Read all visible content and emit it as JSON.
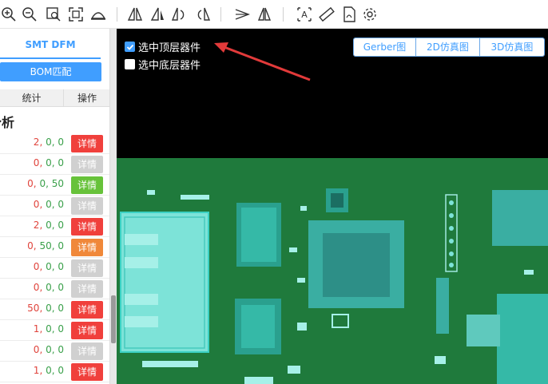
{
  "toolbar": {
    "icons": [
      "zoom-in-icon",
      "zoom-out-icon",
      "zoom-area-icon",
      "fit-view-icon",
      "board-edge-icon",
      "flip-horizontal-icon",
      "flip-vertical-icon",
      "rotate-left-icon",
      "rotate-right-icon",
      "pen-icon",
      "mirror-icon",
      "text-icon",
      "ruler-icon",
      "pdf-icon",
      "gear-icon"
    ]
  },
  "left_panel": {
    "tab": "SMT DFM",
    "bom_button": "BOM匹配",
    "headers": {
      "stat": "统计",
      "op": "操作"
    },
    "section_title": "分析",
    "rows": [
      {
        "a": "2",
        "b": "0",
        "c": "0",
        "op": "详情",
        "status": "red"
      },
      {
        "a": "0",
        "b": "0",
        "c": "0",
        "op": "详情",
        "status": "gray"
      },
      {
        "a": "0",
        "b": "0",
        "c": "50",
        "op": "详情",
        "status": "green"
      },
      {
        "a": "0",
        "b": "0",
        "c": "0",
        "op": "详情",
        "status": "gray"
      },
      {
        "a": "2",
        "b": "0",
        "c": "0",
        "op": "详情",
        "status": "red"
      },
      {
        "a": "0",
        "b": "50",
        "c": "0",
        "op": "详情",
        "status": "orange"
      },
      {
        "a": "0",
        "b": "0",
        "c": "0",
        "op": "详情",
        "status": "gray"
      },
      {
        "a": "0",
        "b": "0",
        "c": "0",
        "op": "详情",
        "status": "gray"
      },
      {
        "a": "50",
        "b": "0",
        "c": "0",
        "op": "详情",
        "status": "red"
      },
      {
        "a": "1",
        "b": "0",
        "c": "0",
        "op": "详情",
        "status": "red"
      },
      {
        "a": "0",
        "b": "0",
        "c": "0",
        "op": "详情",
        "status": "gray"
      },
      {
        "a": "1",
        "b": "0",
        "c": "0",
        "op": "详情",
        "status": "red"
      }
    ]
  },
  "canvas": {
    "select_top": {
      "label": "选中顶层器件",
      "checked": true
    },
    "select_bottom": {
      "label": "选中底层器件",
      "checked": false
    },
    "view_tabs": [
      "Gerber图",
      "2D仿真图",
      "3D仿真图"
    ]
  },
  "colors": {
    "accent": "#409eff",
    "red": "#f0403c",
    "green": "#67c23a",
    "orange": "#f0883a",
    "gray": "#d0d0d0",
    "pcb": "#1f7a3c",
    "pad": "#3bd1c3"
  }
}
